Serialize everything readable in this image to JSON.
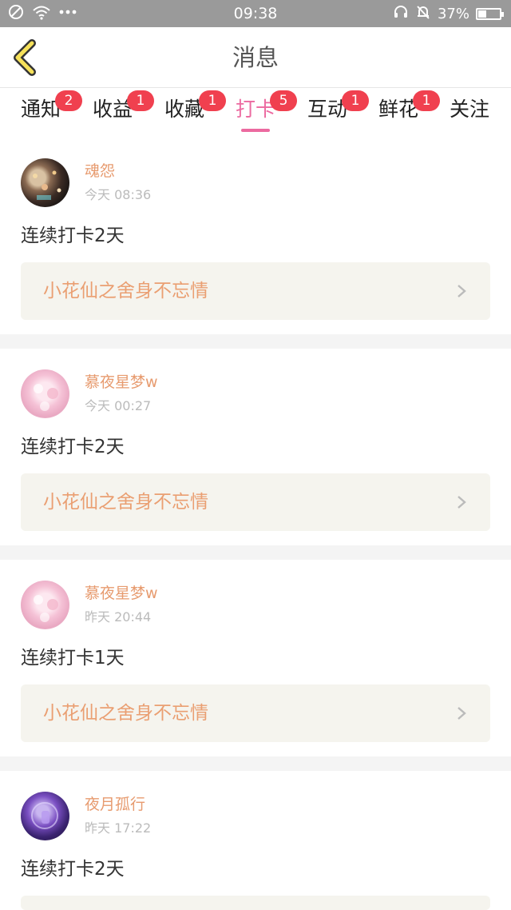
{
  "status_bar": {
    "time": "09:38",
    "battery": "37%",
    "battery_level": 0.37,
    "left_icons": [
      "no-sim-icon",
      "wifi-icon",
      "more-dots-icon"
    ],
    "right_icons": [
      "headset-icon",
      "mute-bell-icon",
      "battery-icon"
    ]
  },
  "header": {
    "title": "消息",
    "back_icon": "chevron-left-icon",
    "accent_color": "#ec6aa0"
  },
  "tabs": [
    {
      "label": "通知",
      "badge": "2",
      "active": false
    },
    {
      "label": "收益",
      "badge": "1",
      "active": false
    },
    {
      "label": "收藏",
      "badge": "1",
      "active": false
    },
    {
      "label": "打卡",
      "badge": "5",
      "active": true
    },
    {
      "label": "互动",
      "badge": "1",
      "active": false
    },
    {
      "label": "鲜花",
      "badge": "1",
      "active": false
    },
    {
      "label": "关注",
      "badge": "",
      "active": false
    }
  ],
  "feed": [
    {
      "username": "魂怨",
      "time": "今天 08:36",
      "content": "连续打卡2天",
      "link": "小花仙之舍身不忘情"
    },
    {
      "username": "慕夜星梦w",
      "time": "今天 00:27",
      "content": "连续打卡2天",
      "link": "小花仙之舍身不忘情"
    },
    {
      "username": "慕夜星梦w",
      "time": "昨天 20:44",
      "content": "连续打卡1天",
      "link": "小花仙之舍身不忘情"
    },
    {
      "username": "夜月孤行",
      "time": "昨天 17:22",
      "content": "连续打卡2天",
      "link": ""
    }
  ],
  "colors": {
    "username": "#e79b6f",
    "link_text": "#ea9f72",
    "link_bg": "#f5f4ee",
    "badge": "#f0404f",
    "status_bar": "#9a9a9a"
  }
}
